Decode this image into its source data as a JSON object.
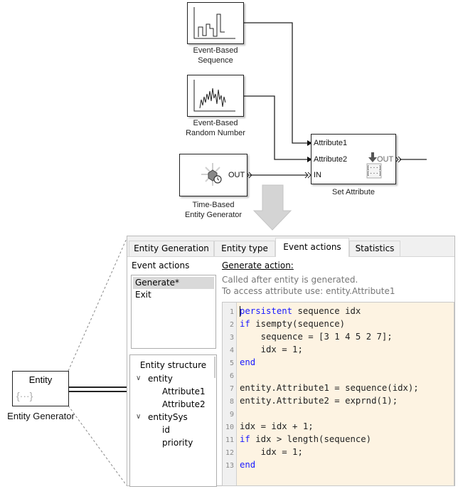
{
  "blocks": {
    "sequence": {
      "label_line1": "Event-Based",
      "label_line2": "Sequence"
    },
    "random": {
      "label_line1": "Event-Based",
      "label_line2": "Random Number"
    },
    "time_gen": {
      "label_line1": "Time-Based",
      "label_line2": "Entity Generator",
      "out_port": "OUT"
    },
    "set_attr": {
      "label": "Set Attribute",
      "ports_in": [
        "Attribute1",
        "Attribute2",
        "IN"
      ],
      "out_port": "OUT"
    },
    "entity_gen": {
      "title": "Entity",
      "icon_text": "{···}",
      "label": "Entity Generator"
    }
  },
  "dialog": {
    "tabs": [
      {
        "label": "Entity Generation",
        "active": false
      },
      {
        "label": "Entity type",
        "active": false
      },
      {
        "label": "Event actions",
        "active": true
      },
      {
        "label": "Statistics",
        "active": false
      }
    ],
    "event_actions_label": "Event actions",
    "event_actions": [
      {
        "label": "Generate*",
        "selected": true
      },
      {
        "label": "Exit",
        "selected": false
      }
    ],
    "entity_structure": {
      "title": "Entity structure",
      "nodes": [
        {
          "label": "entity",
          "expanded": true,
          "children": [
            "Attribute1",
            "Attribute2"
          ]
        },
        {
          "label": "entitySys",
          "expanded": true,
          "children": [
            "id",
            "priority"
          ]
        }
      ]
    },
    "generate_action_heading": "Generate action:",
    "hint_line1": "Called after entity is generated.",
    "hint_line2": "To access attribute use: entity.Attribute1",
    "code_lines": [
      {
        "n": "1",
        "kw": "persistent",
        "rest": " sequence idx",
        "indent": ""
      },
      {
        "n": "2",
        "kw": "if",
        "rest": " isempty(sequence)",
        "indent": ""
      },
      {
        "n": "3",
        "kw": "",
        "rest": "sequence = [3 1 4 5 2 7];",
        "indent": "    "
      },
      {
        "n": "4",
        "kw": "",
        "rest": "idx = 1;",
        "indent": "    "
      },
      {
        "n": "5",
        "kw": "end",
        "rest": "",
        "indent": ""
      },
      {
        "n": "6",
        "kw": "",
        "rest": "",
        "indent": ""
      },
      {
        "n": "7",
        "kw": "",
        "rest": "entity.Attribute1 = sequence(idx);",
        "indent": ""
      },
      {
        "n": "8",
        "kw": "",
        "rest": "entity.Attribute2 = exprnd(1);",
        "indent": ""
      },
      {
        "n": "9",
        "kw": "",
        "rest": "",
        "indent": ""
      },
      {
        "n": "10",
        "kw": "",
        "rest": "idx = idx + 1;",
        "indent": ""
      },
      {
        "n": "11",
        "kw": "if",
        "rest": " idx > length(sequence)",
        "indent": ""
      },
      {
        "n": "12",
        "kw": "",
        "rest": "idx = 1;",
        "indent": "    "
      },
      {
        "n": "13",
        "kw": "end",
        "rest": "",
        "indent": ""
      }
    ]
  },
  "colors": {
    "keyword": "#1a1aff",
    "code_bg": "#fdf3e2",
    "arrow_fill": "#d4d4d4"
  }
}
